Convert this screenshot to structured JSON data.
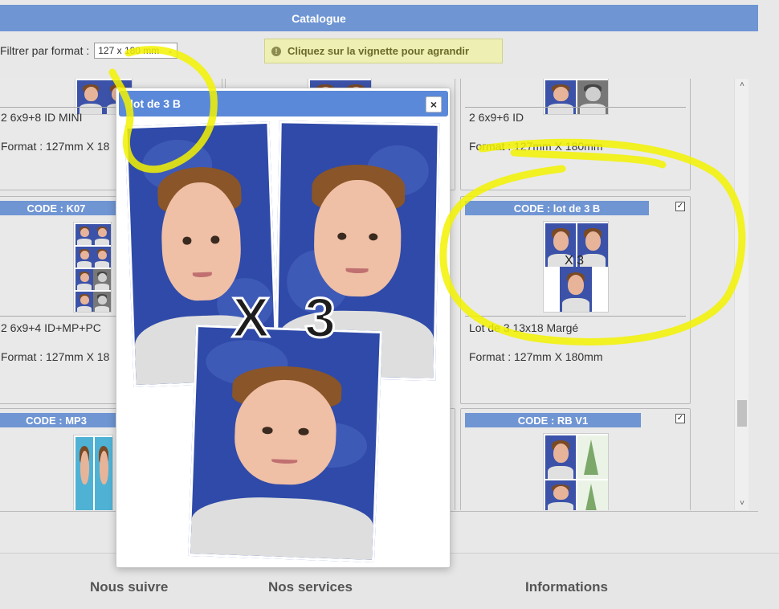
{
  "header": {
    "title": "Catalogue"
  },
  "filter": {
    "label": "Filtrer par format :",
    "selected": "127 x 180 mm"
  },
  "info": {
    "text": "Cliquez sur la vignette pour agrandir"
  },
  "cards": {
    "top_left": {
      "name": "2 6x9+8 ID MINI",
      "format": "Format : 127mm X 18"
    },
    "top_right": {
      "name": "2 6x9+6 ID",
      "format": "Format : 127mm X 180mm"
    },
    "mid_left": {
      "code": "CODE : K07",
      "name": "2 6x9+4 ID+MP+PC",
      "format": "Format : 127mm X 18"
    },
    "mid_right": {
      "code": "CODE : lot de 3 B",
      "thumb_overlay": "X 3",
      "name": "Lot de 3 13x18 Margé",
      "format": "Format : 127mm X 180mm"
    },
    "bot_left": {
      "code": "CODE : MP3"
    },
    "bot_right": {
      "code": "CODE : RB V1"
    }
  },
  "modal": {
    "title": "lot de 3 B",
    "close_label": "×",
    "overlay_text": "X 3"
  },
  "footer": {
    "col1": "Nous suivre",
    "col2": "Nos services",
    "col3": "Informations"
  },
  "scroll": {
    "up": "˄",
    "down": "˅"
  },
  "colors": {
    "accent": "#6f95d3",
    "modal_title": "#5b89d9",
    "highlight": "#f2f200",
    "banner_bg": "#eef0b3"
  }
}
